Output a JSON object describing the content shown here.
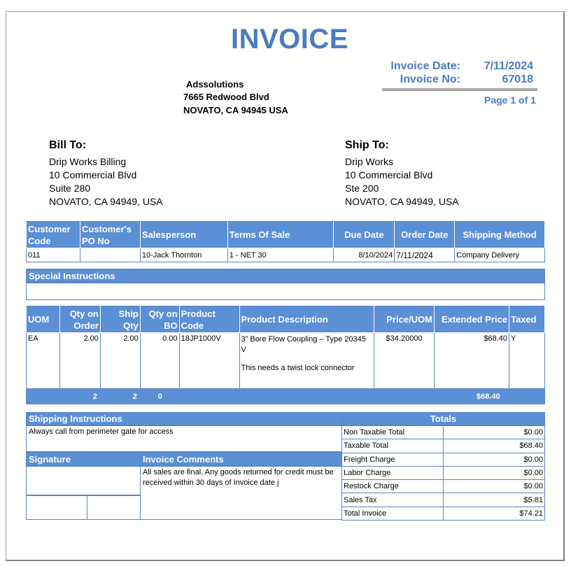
{
  "title": "INVOICE",
  "meta": {
    "date_label": "Invoice Date:",
    "date_value": "7/11/2024",
    "no_label": "Invoice No:",
    "no_value": "67018",
    "page": "Page 1 of 1"
  },
  "company": {
    "name": "Adssolutions",
    "street": "7665 Redwood Blvd",
    "city": "NOVATO, CA 94945 USA"
  },
  "bill_to": {
    "heading": "Bill To:",
    "lines": [
      "Drip Works Billing",
      "10 Commercial Blvd",
      "Suite 280",
      "NOVATO, CA 94949, USA"
    ]
  },
  "ship_to": {
    "heading": "Ship To:",
    "lines": [
      "Drip Works",
      "10 Commercial Blvd",
      "Ste 200",
      "NOVATO, CA 94949, USA"
    ]
  },
  "order_info": {
    "headers": [
      "Customer Code",
      "Customer's PO No",
      "Salesperson",
      "Terms Of Sale",
      "Due Date",
      "Order Date",
      "Shipping Method"
    ],
    "values": [
      "011",
      "",
      "10-Jack Thornton",
      "1 - NET 30",
      "8/10/2024",
      "7/11/2024",
      "Company Delivery"
    ]
  },
  "special_instructions": {
    "label": "Special Instructions",
    "text": ""
  },
  "items": {
    "headers": [
      "UOM",
      "Qty on Order",
      "Ship Qty",
      "Qty on BO",
      "Product Code",
      "Product Description",
      "Price/UOM",
      "Extended Price",
      "Taxed"
    ],
    "rows": [
      {
        "uom": "EA",
        "qty_order": "2.00",
        "ship_qty": "2.00",
        "qty_bo": "0.00",
        "code": "18JP1000V",
        "desc": "3” Bore Flow Coupling – Type 20345 V",
        "note": "This needs a twist lock connector",
        "price": "$34.20000",
        "extended": "$68.40",
        "taxed": "Y"
      }
    ],
    "totals": {
      "qty_order": "2",
      "ship_qty": "2",
      "qty_bo": "0",
      "extended": "$68.40"
    }
  },
  "shipping_instructions": {
    "label": "Shipping Instructions",
    "text": "Always call from perimeter gate for access"
  },
  "signature": {
    "label": "Signature"
  },
  "invoice_comments": {
    "label": "Invoice Comments",
    "text": "All sales are final. Any goods returned for credit must be received within 30 days of Invoice date j"
  },
  "totals": {
    "label": "Totals",
    "rows": [
      {
        "label": "Non Taxable Total",
        "value": "$0.00"
      },
      {
        "label": "Taxable Total",
        "value": "$68.40"
      },
      {
        "label": "Freight Charge",
        "value": "$0.00"
      },
      {
        "label": "Labor Charge",
        "value": "$0.00"
      },
      {
        "label": "Restock Charge",
        "value": "$0.00"
      },
      {
        "label": "Sales Tax",
        "value": "$5.81"
      },
      {
        "label": "Total Invoice",
        "value": "$74.21"
      }
    ]
  },
  "colors": {
    "accent": "#4a7cc0",
    "band": "#5b8fd6"
  }
}
